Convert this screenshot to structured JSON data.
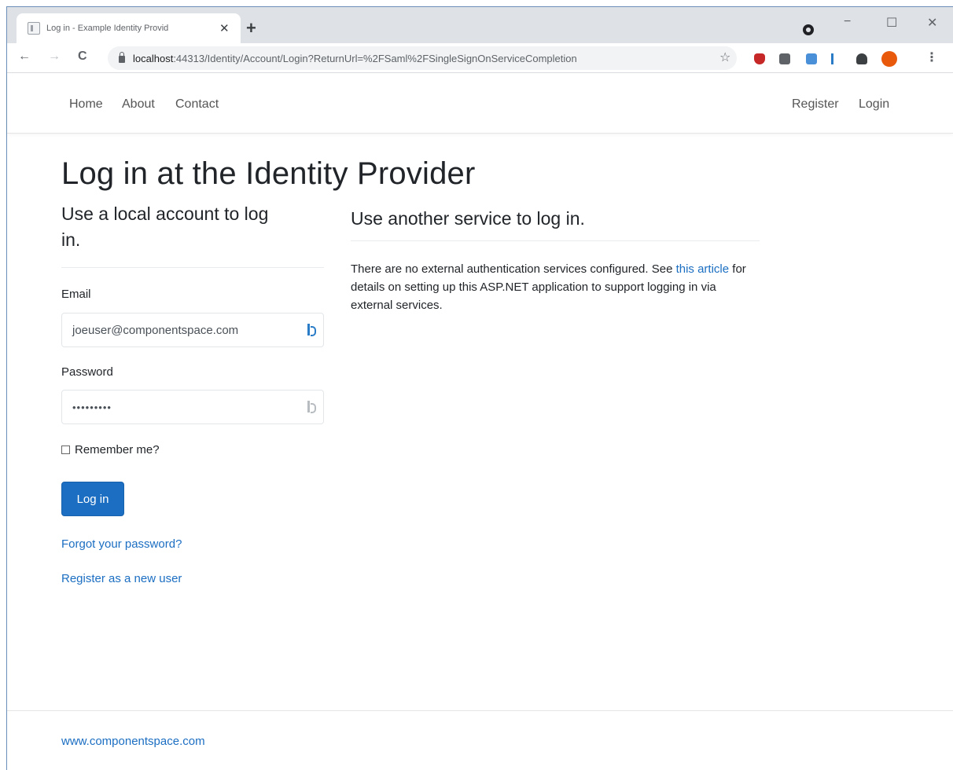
{
  "browser": {
    "tab_title": "Log in - Example Identity Provid",
    "tab_close": "✕",
    "new_tab": "+",
    "url_host": "localhost",
    "url_rest": ":44313/Identity/Account/Login?ReturnUrl=%2FSaml%2FSingleSignOnServiceCompletion",
    "back": "←",
    "forward": "→",
    "reload": "C",
    "star": "☆",
    "menu": "⋮",
    "window_controls": {
      "minimize": "−",
      "maximize": "☐",
      "close": "✕"
    }
  },
  "navbar": {
    "left": [
      "Home",
      "About",
      "Contact"
    ],
    "right": [
      "Register",
      "Login"
    ]
  },
  "main": {
    "title": "Log in at the Identity Provider",
    "local": {
      "heading_line1": "Use a local account to log",
      "heading_line2": "in.",
      "email_label": "Email",
      "email_value": "joeuser@componentspace.com",
      "password_label": "Password",
      "password_value": "•••••••••",
      "remember_label": "Remember me?",
      "login_button": "Log in",
      "forgot_link": "Forgot your password?",
      "register_link": "Register as a new user"
    },
    "external": {
      "heading": "Use another service to log in.",
      "text_before": "There are no external authentication services configured. See ",
      "link_text": "this article",
      "text_after": " for details on setting up this ASP.NET application to support logging in via external services."
    }
  },
  "footer": {
    "link": "www.componentspace.com"
  },
  "colors": {
    "link": "#1b6ec2",
    "primary_button": "#1b6ec2",
    "tabstrip": "#dee1e6"
  }
}
